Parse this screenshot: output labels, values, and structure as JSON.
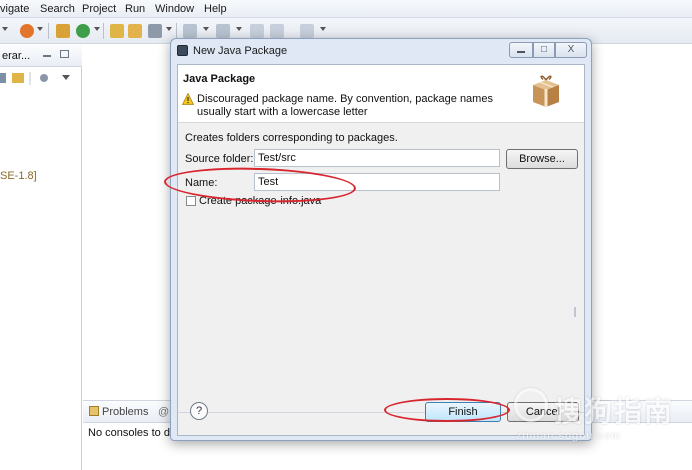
{
  "menubar": {
    "items": [
      "vigate",
      "Search",
      "Project",
      "Run",
      "Window",
      "Help"
    ]
  },
  "left_view": {
    "title": "erar...",
    "jre_label": "SE-1.8]"
  },
  "bottom_view": {
    "problems_tab": "Problems",
    "second_tab_prefix": "@",
    "console_text": "No consoles to di"
  },
  "dialog": {
    "title": "New Java Package",
    "banner_title": "Java Package",
    "warning_message": "Discouraged package name. By convention, package names usually start with a lowercase letter",
    "description": "Creates folders corresponding to packages.",
    "source_folder_label": "Source folder:",
    "source_folder_value": "Test/src",
    "browse_label": "Browse...",
    "name_label": "Name:",
    "name_value": "Test",
    "create_package_info_label": "Create package-info.java",
    "create_package_info_checked": false,
    "help_label": "?",
    "finish_label": "Finish",
    "cancel_label": "Cancel",
    "window_buttons": {
      "restore": "□",
      "close": "X"
    }
  },
  "watermark": {
    "text": "搜狗指南",
    "sub": "zhinan.sogou.com",
    "circle_glyph": "S"
  },
  "colors": {
    "annotation_red": "#d8262f",
    "dialog_frame": "#dfe8f4",
    "finish_button": "#bee6fd"
  }
}
